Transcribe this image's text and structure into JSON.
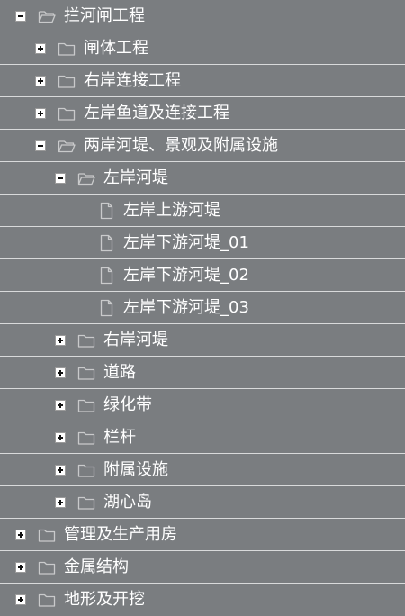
{
  "tree": {
    "nodes": [
      {
        "label": "拦河闸工程",
        "level": 0,
        "type": "folder",
        "state": "expanded"
      },
      {
        "label": "闸体工程",
        "level": 1,
        "type": "folder",
        "state": "collapsed"
      },
      {
        "label": "右岸连接工程",
        "level": 1,
        "type": "folder",
        "state": "collapsed"
      },
      {
        "label": "左岸鱼道及连接工程",
        "level": 1,
        "type": "folder",
        "state": "collapsed"
      },
      {
        "label": "两岸河堤、景观及附属设施",
        "level": 1,
        "type": "folder",
        "state": "expanded"
      },
      {
        "label": "左岸河堤",
        "level": 2,
        "type": "folder",
        "state": "expanded"
      },
      {
        "label": "左岸上游河堤",
        "level": 3,
        "type": "file",
        "state": "leaf"
      },
      {
        "label": "左岸下游河堤_01",
        "level": 3,
        "type": "file",
        "state": "leaf"
      },
      {
        "label": "左岸下游河堤_02",
        "level": 3,
        "type": "file",
        "state": "leaf"
      },
      {
        "label": "左岸下游河堤_03",
        "level": 3,
        "type": "file",
        "state": "leaf"
      },
      {
        "label": "右岸河堤",
        "level": 2,
        "type": "folder",
        "state": "collapsed"
      },
      {
        "label": "道路",
        "level": 2,
        "type": "folder",
        "state": "collapsed"
      },
      {
        "label": "绿化带",
        "level": 2,
        "type": "folder",
        "state": "collapsed"
      },
      {
        "label": "栏杆",
        "level": 2,
        "type": "folder",
        "state": "collapsed"
      },
      {
        "label": "附属设施",
        "level": 2,
        "type": "folder",
        "state": "collapsed"
      },
      {
        "label": "湖心岛",
        "level": 2,
        "type": "folder",
        "state": "collapsed"
      },
      {
        "label": "管理及生产用房",
        "level": 0,
        "type": "folder",
        "state": "collapsed"
      },
      {
        "label": "金属结构",
        "level": 0,
        "type": "folder",
        "state": "collapsed"
      },
      {
        "label": "地形及开挖",
        "level": 0,
        "type": "folder",
        "state": "collapsed"
      }
    ]
  },
  "colors": {
    "background": "#7a7d80",
    "separator": "#d9dadb",
    "text": "#ffffff",
    "icon_stroke": "#c9cacb"
  },
  "icons": {
    "folder_closed": "folder-icon",
    "folder_open": "folder-open-icon",
    "file": "file-icon",
    "expand": "expand-plus-icon",
    "collapse": "collapse-minus-icon"
  }
}
